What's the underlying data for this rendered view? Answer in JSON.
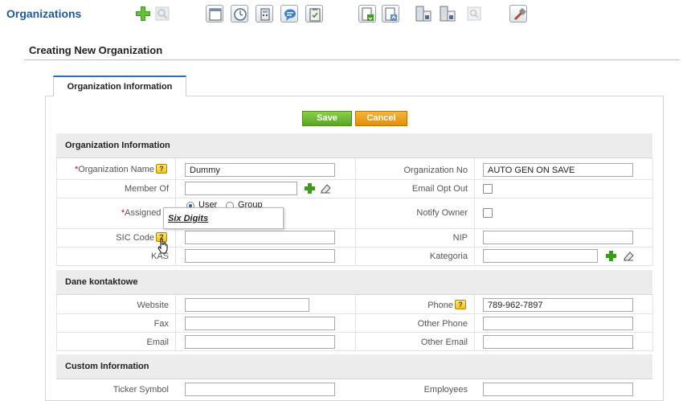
{
  "app": {
    "title": "Organizations"
  },
  "toolbar": {
    "icons": [
      "create-icon",
      "search-icon",
      "calendar-icon",
      "clock-icon",
      "calculator-icon",
      "chat-icon",
      "import-icon",
      "export-icon",
      "duplicates-icon",
      "merge-icon",
      "tag-cloud-icon",
      "settings-icon"
    ]
  },
  "page": {
    "title": "Creating New Organization"
  },
  "tabs": [
    {
      "label": "Organization Information"
    }
  ],
  "actions": {
    "save_label": "Save",
    "cancel_label": "Cancel"
  },
  "sections": {
    "org_info": {
      "title": "Organization Information",
      "org_name_label": "Organization Name",
      "org_name_value": "Dummy",
      "org_no_label": "Organization No",
      "org_no_value": "AUTO GEN ON SAVE",
      "member_of_label": "Member Of",
      "email_opt_out_label": "Email Opt Out",
      "assigned_to_label": "Assigned T",
      "assign_user_label": "User",
      "assign_group_label": "Group",
      "notify_owner_label": "Notify Owner",
      "sic_code_label": "SIC Code",
      "nip_label": "NIP",
      "kas_label": "KAS",
      "kategoria_label": "Kategoria"
    },
    "contact": {
      "title": "Dane kontaktowe",
      "website_label": "Website",
      "phone_label": "Phone",
      "phone_value": "789-962-7897",
      "fax_label": "Fax",
      "other_phone_label": "Other Phone",
      "email_label": "Email",
      "other_email_label": "Other Email"
    },
    "custom": {
      "title": "Custom Information",
      "ticker_label": "Ticker Symbol",
      "employees_label": "Employees"
    }
  },
  "tooltip": {
    "text": "Six Digits"
  },
  "colors": {
    "accent": "#2c6fb3",
    "save": "#6dbb32",
    "cancel": "#eba022",
    "required": "#d00000"
  }
}
